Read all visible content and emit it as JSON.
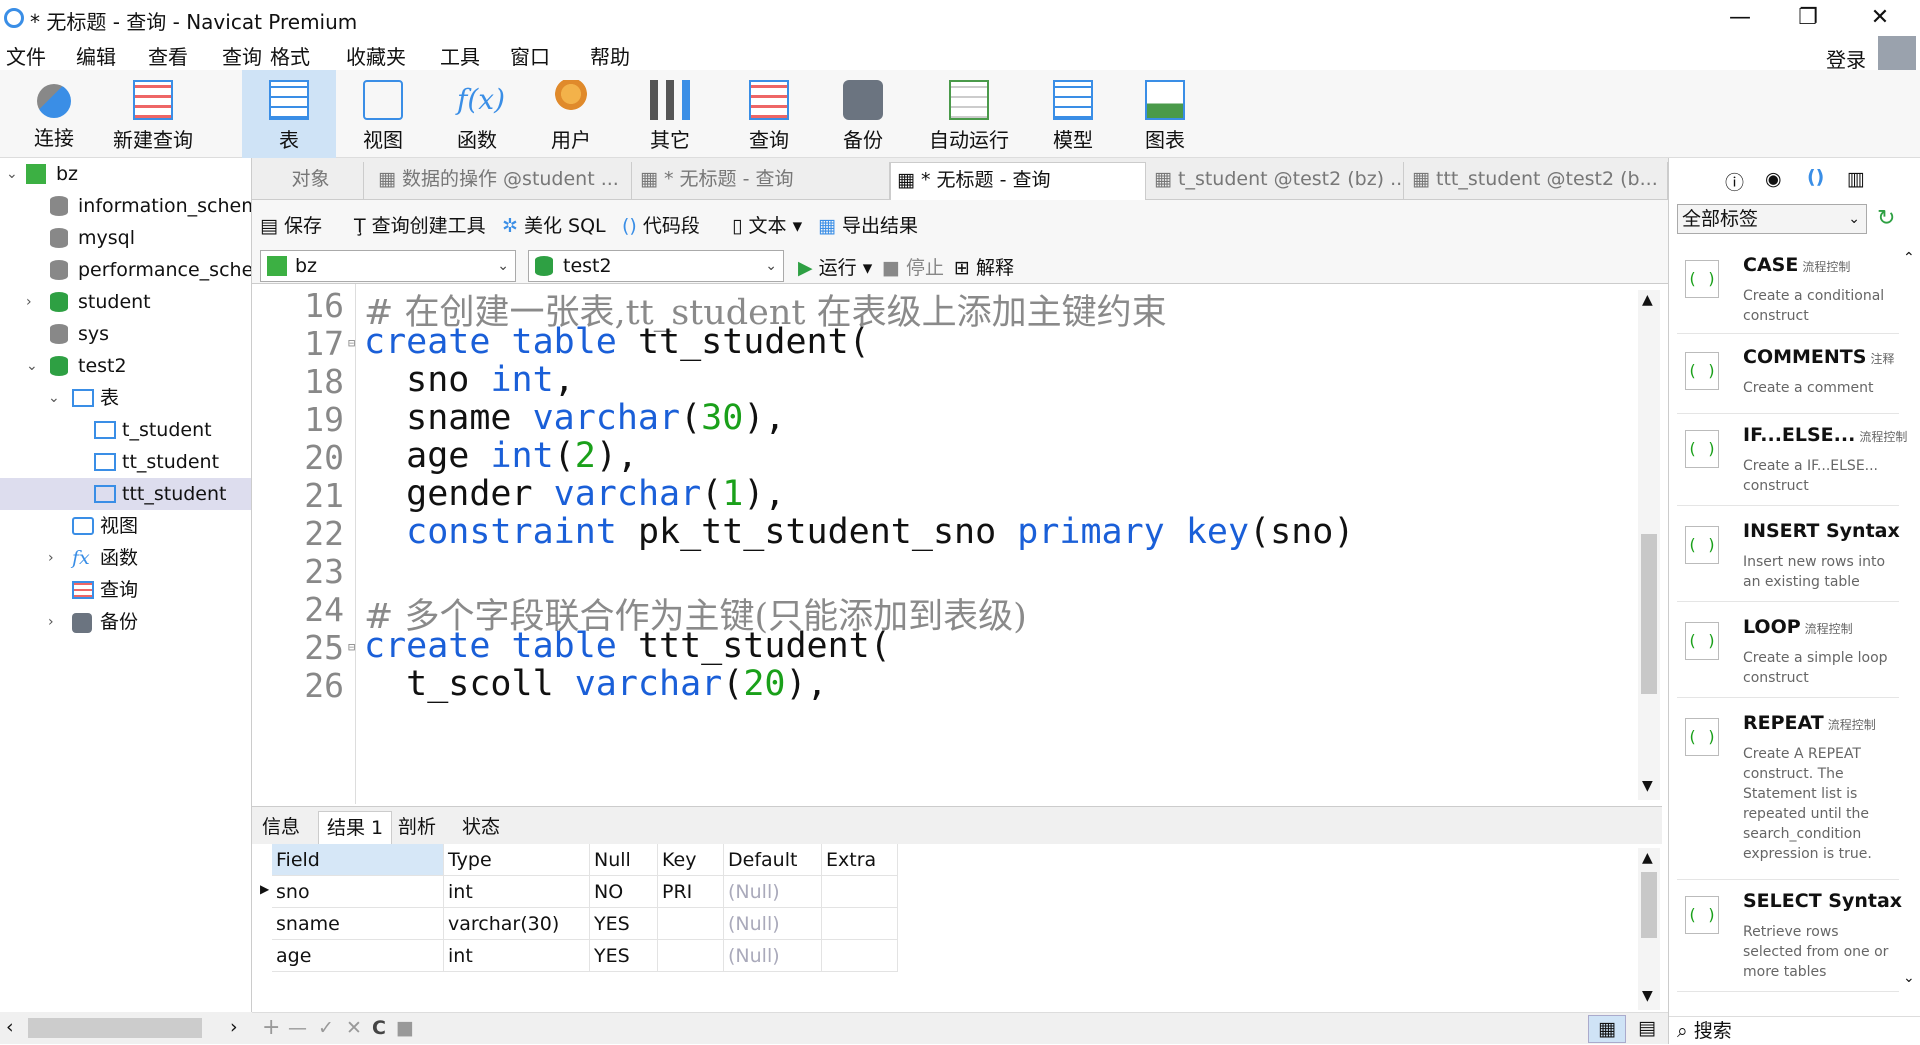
{
  "titlebar": {
    "title": "* 无标题 - 查询 - Navicat Premium",
    "minimize": "—",
    "maximize": "❐",
    "close": "✕"
  },
  "menu": {
    "items": [
      "文件",
      "编辑",
      "查看",
      "查询",
      "格式",
      "收藏夹",
      "工具",
      "窗口",
      "帮助"
    ],
    "login": "登录"
  },
  "toolbar": {
    "buttons": [
      "连接",
      "新建查询",
      "表",
      "视图",
      "函数",
      "用户",
      "其它",
      "查询",
      "备份",
      "自动运行",
      "模型",
      "图表"
    ]
  },
  "tree": {
    "nodes": [
      "bz",
      "information_schem",
      "mysql",
      "performance_sche",
      "student",
      "sys",
      "test2",
      "表",
      "t_student",
      "tt_student",
      "ttt_student",
      "视图",
      "函数",
      "查询",
      "备份"
    ]
  },
  "tabs": {
    "items": [
      "对象",
      "数据的操作 @student ...",
      "* 无标题 - 查询",
      "* 无标题 - 查询",
      "t_student @test2 (bz) ...",
      "ttt_student @test2 (b..."
    ]
  },
  "query_toolbar": {
    "save": "保存",
    "builder": "查询创建工具",
    "beautify": "美化 SQL",
    "snippet": "代码段",
    "text": "文本",
    "export": "导出结果"
  },
  "selectors": {
    "connection": "bz",
    "database": "test2",
    "run": "运行",
    "stop": "停止",
    "explain": "解释"
  },
  "editor": {
    "line_numbers": [
      "16",
      "17",
      "18",
      "19",
      "20",
      "21",
      "22",
      "23",
      "24",
      "25",
      "26"
    ],
    "l16": "# 在创建一张表,tt_student 在表级上添加主键约束",
    "l17a": "create table",
    "l17b": " tt_student(",
    "l18a": "  sno ",
    "l18b": "int",
    "l18c": ",",
    "l19a": "  sname ",
    "l19b": "varchar",
    "l19c": "(",
    "l19d": "30",
    "l19e": "),",
    "l20a": "  age ",
    "l20b": "int",
    "l20c": "(",
    "l20d": "2",
    "l20e": "),",
    "l21a": "  gender ",
    "l21b": "varchar",
    "l21c": "(",
    "l21d": "1",
    "l21e": "),",
    "l22a": "  ",
    "l22b": "constraint",
    "l22c": " pk_tt_student_sno ",
    "l22d": "primary key",
    "l22e": "(sno)",
    "l24": "# 多个字段联合作为主键(只能添加到表级)",
    "l25a": "create table",
    "l25b": " ttt_student(",
    "l26a": "  t_scoll ",
    "l26b": "varchar",
    "l26c": "(",
    "l26d": "20",
    "l26e": "),"
  },
  "result_tabs": [
    "信息",
    "结果 1",
    "剖析",
    "状态"
  ],
  "grid": {
    "headers": [
      "Field",
      "Type",
      "Null",
      "Key",
      "Default",
      "Extra"
    ],
    "rows": [
      [
        "sno",
        "int",
        "NO",
        "PRI",
        "(Null)",
        ""
      ],
      [
        "sname",
        "varchar(30)",
        "YES",
        "",
        "(Null)",
        ""
      ],
      [
        "age",
        "int",
        "YES",
        "",
        "(Null)",
        ""
      ]
    ]
  },
  "bottom": {
    "add": "+",
    "remove": "—",
    "apply": "✓",
    "cancel": "✕",
    "refresh": "C",
    "stop": "■"
  },
  "right": {
    "tag_select": "全部标签",
    "search": "搜索",
    "snippets": [
      {
        "title": "CASE",
        "group": "流程控制",
        "desc": "Create a conditional construct"
      },
      {
        "title": "COMMENTS",
        "group": "注释",
        "desc": "Create a comment"
      },
      {
        "title": "IF...ELSE...",
        "group": "流程控制",
        "desc": "Create a IF...ELSE... construct"
      },
      {
        "title": "INSERT Syntax",
        "group": "",
        "desc": "Insert new rows into an existing table"
      },
      {
        "title": "LOOP",
        "group": "流程控制",
        "desc": "Create a simple loop construct"
      },
      {
        "title": "REPEAT",
        "group": "流程控制",
        "desc": "Create A REPEAT construct. The Statement list is repeated until the search_condition expression is true."
      },
      {
        "title": "SELECT Syntax",
        "group": "",
        "desc": "Retrieve rows selected from one or more tables"
      }
    ]
  }
}
